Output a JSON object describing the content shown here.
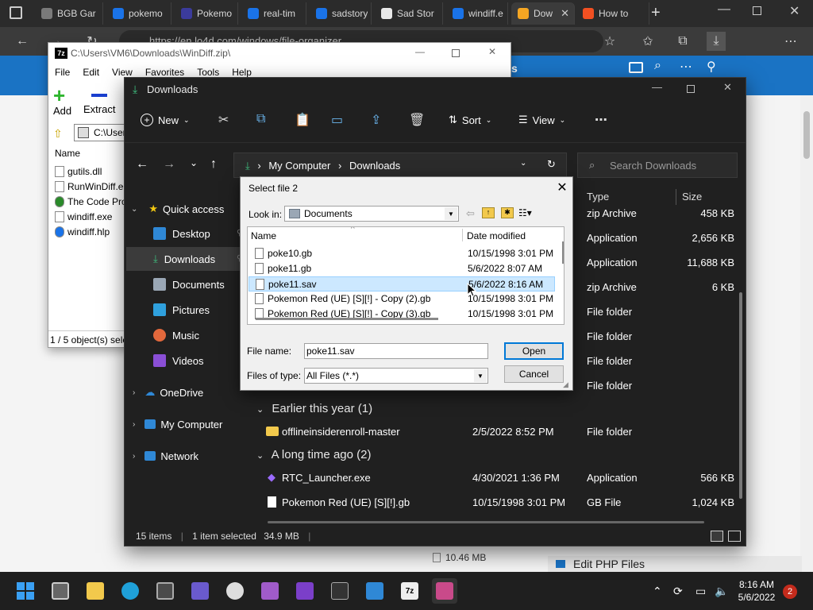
{
  "browser": {
    "tabs": [
      {
        "label": "BGB Gar",
        "fav_color": "#7a7a7a"
      },
      {
        "label": "pokemo",
        "fav_color": "#1a73e8"
      },
      {
        "label": "Pokemo",
        "fav_color": "#3b3b9b"
      },
      {
        "label": "real-tim",
        "fav_color": "#1a73e8"
      },
      {
        "label": "sadstory",
        "fav_color": "#1a73e8"
      },
      {
        "label": "Sad Stor",
        "fav_color": "#e8e8e8"
      },
      {
        "label": "windiff.e",
        "fav_color": "#1a73e8"
      },
      {
        "label": "Dow",
        "fav_color": "#f5a623"
      },
      {
        "label": "How to",
        "fav_color": "#f25022"
      }
    ],
    "address": "https://en.lo4d.com/windows/file-organizer"
  },
  "webpage": {
    "banner_text": "s",
    "footer_size": "10.46 MB",
    "footer_link": "Edit PHP Files"
  },
  "zip": {
    "title": "C:\\Users\\VM6\\Downloads\\WinDiff.zip\\",
    "menu": [
      "File",
      "Edit",
      "View",
      "Favorites",
      "Tools",
      "Help"
    ],
    "add_label": "Add",
    "extract_label": "Extract",
    "path": "C:\\User",
    "column_name": "Name",
    "files": [
      "gutils.dll",
      "RunWinDiff.e",
      "The Code Pro",
      "windiff.exe",
      "windiff.hlp"
    ],
    "status": "1 / 5 object(s) sele"
  },
  "explorer": {
    "title": "Downloads",
    "cmd_new": "New",
    "cmd_sort": "Sort",
    "cmd_view": "View",
    "breadcrumb": [
      "My Computer",
      "Downloads"
    ],
    "search_placeholder": "Search Downloads",
    "col_type": "Type",
    "col_size": "Size",
    "nav": {
      "quick_access": "Quick access",
      "desktop": "Desktop",
      "downloads": "Downloads",
      "documents": "Documents",
      "pictures": "Pictures",
      "music": "Music",
      "videos": "Videos",
      "onedrive": "OneDrive",
      "my_computer": "My Computer",
      "network": "Network"
    },
    "visible_rows": [
      {
        "type": "zip Archive",
        "size": "458 KB"
      },
      {
        "type": "Application",
        "size": "2,656 KB"
      },
      {
        "type": "Application",
        "size": "11,688 KB"
      },
      {
        "type": "zip Archive",
        "size": "6 KB"
      },
      {
        "type": "File folder",
        "size": ""
      },
      {
        "type": "File folder",
        "size": ""
      },
      {
        "type": "File folder",
        "size": ""
      },
      {
        "type": "File folder",
        "size": ""
      }
    ],
    "group_earlier": "Earlier this year (1)",
    "group_earlier_rows": [
      {
        "name": "offlineinsiderenroll-master",
        "date": "2/5/2022 8:52 PM",
        "type": "File folder",
        "size": ""
      }
    ],
    "group_long_ago": "A long time ago (2)",
    "group_long_ago_rows": [
      {
        "name": "RTC_Launcher.exe",
        "date": "4/30/2021 1:36 PM",
        "type": "Application",
        "size": "566 KB"
      },
      {
        "name": "Pokemon Red (UE) [S][!].gb",
        "date": "10/15/1998 3:01 PM",
        "type": "GB File",
        "size": "1,024 KB"
      }
    ],
    "status_items": "15 items",
    "status_selected": "1 item selected",
    "status_size": "34.9 MB"
  },
  "dialog": {
    "title": "Select file 2",
    "look_in_label": "Look in:",
    "look_in_value": "Documents",
    "col_name": "Name",
    "col_date": "Date modified",
    "files": [
      {
        "name": "poke10.gb",
        "date": "10/15/1998 3:01 PM",
        "selected": false
      },
      {
        "name": "poke11.gb",
        "date": "5/6/2022 8:07 AM",
        "selected": false
      },
      {
        "name": "poke11.sav",
        "date": "5/6/2022 8:16 AM",
        "selected": true
      },
      {
        "name": "Pokemon Red (UE) [S][!] - Copy (2).gb",
        "date": "10/15/1998 3:01 PM",
        "selected": false
      },
      {
        "name": "Pokemon Red (UE) [S][!] - Copy (3).gb",
        "date": "10/15/1998 3:01 PM",
        "selected": false
      }
    ],
    "file_name_label": "File name:",
    "file_name_value": "poke11.sav",
    "file_type_label": "Files of type:",
    "file_type_value": "All Files (*.*)",
    "open_label": "Open",
    "cancel_label": "Cancel"
  },
  "taskbar": {
    "time": "8:16 AM",
    "date": "5/6/2022",
    "notification_count": "2"
  }
}
